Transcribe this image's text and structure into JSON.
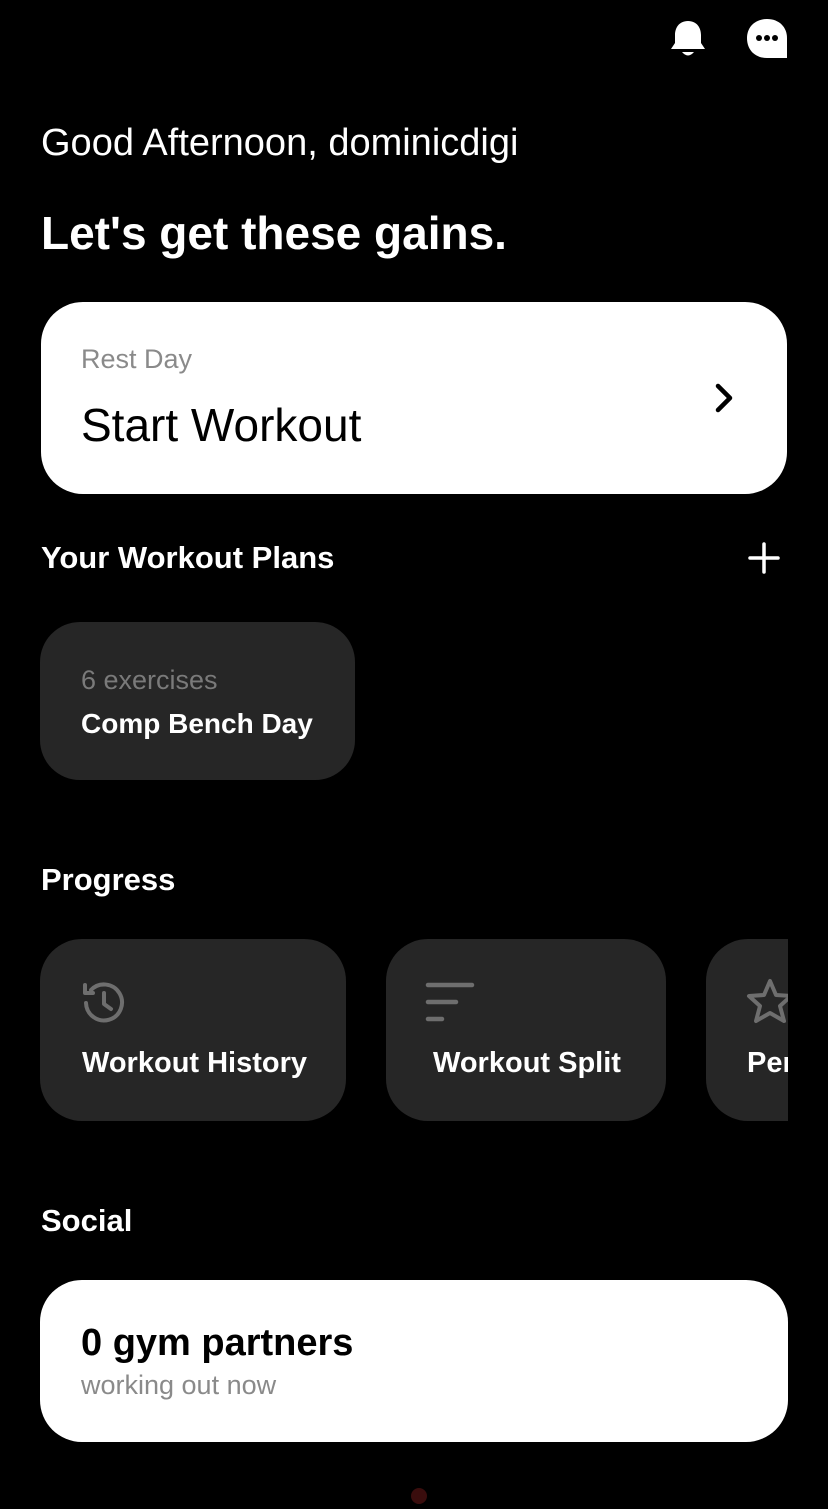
{
  "header": {
    "icons": [
      "bell-icon",
      "more-icon"
    ]
  },
  "greeting": "Good Afternoon, dominicdigi",
  "tagline": "Let's get these gains.",
  "start_card": {
    "subtitle": "Rest Day",
    "title": "Start Workout",
    "icon": "chevron-right-icon"
  },
  "plans": {
    "title": "Your Workout Plans",
    "add_icon": "plus-icon",
    "items": [
      {
        "count": "6 exercises",
        "name": "Comp Bench Day"
      }
    ]
  },
  "progress": {
    "title": "Progress",
    "items": [
      {
        "label": "Workout History",
        "icon": "history-icon"
      },
      {
        "label": "Workout Split",
        "icon": "split-lines-icon"
      },
      {
        "label": "Personal Records",
        "icon": "star-icon"
      }
    ]
  },
  "social": {
    "title": "Social",
    "partners": "0 gym partners",
    "status": "working out now"
  },
  "colors": {
    "background": "#000000",
    "card_dark": "#262626",
    "card_light": "#ffffff",
    "muted_text": "#8a8a8a"
  }
}
